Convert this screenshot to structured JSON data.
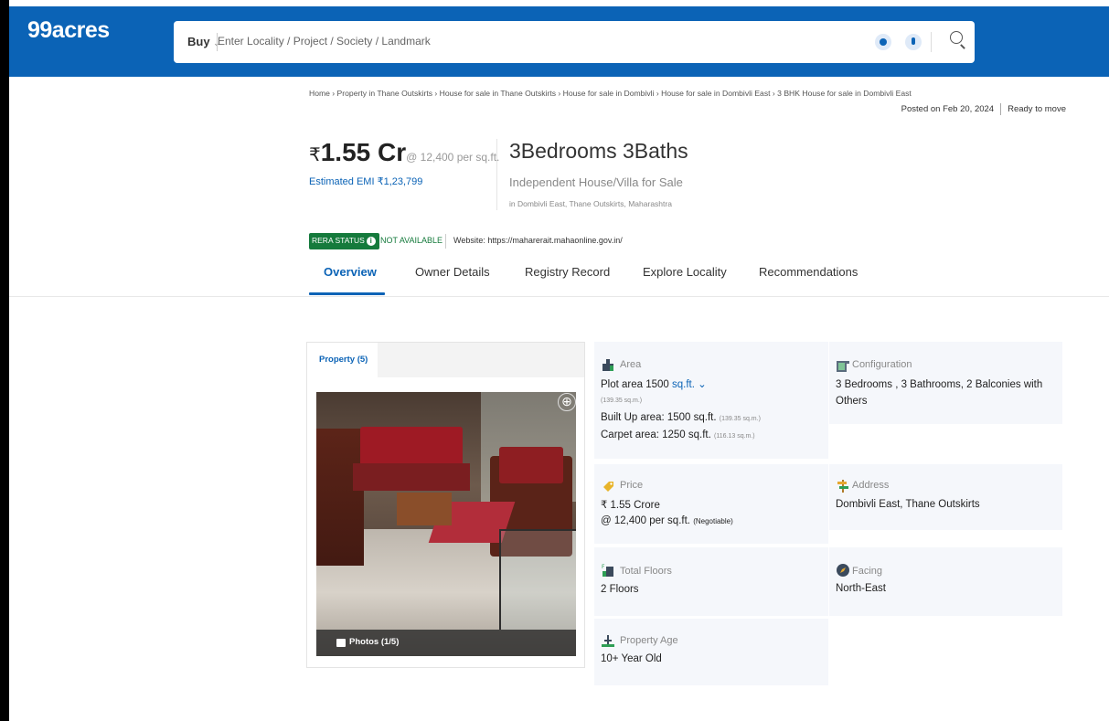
{
  "header": {
    "logo": "99acres",
    "buy_label": "Buy",
    "search_placeholder": "Enter Locality / Project / Society / Landmark"
  },
  "breadcrumb": "Home › Property in Thane Outskirts › House for sale in Thane Outskirts › House for sale in Dombivli › House for sale in Dombivli East › 3 BHK House for sale in Dombivli East",
  "posted": {
    "date": "Posted on Feb 20, 2024",
    "status": "Ready to move"
  },
  "price": {
    "symbol": "₹",
    "main": "1.55 Cr",
    "rate": "@ 12,400 per sq.ft.",
    "emi": "Estimated EMI ₹1,23,799"
  },
  "summary": {
    "bhk": "3Bedrooms 3Baths",
    "type": "Independent House/Villa for Sale",
    "location": "in Dombivli East, Thane Outskirts, Maharashtra"
  },
  "rera": {
    "status_label": "RERA STATUS",
    "status_value": "NOT AVAILABLE",
    "website": "Website: https://maharerait.mahaonline.gov.in/"
  },
  "tabs": [
    {
      "label": "Overview"
    },
    {
      "label": "Owner Details"
    },
    {
      "label": "Registry Record"
    },
    {
      "label": "Explore Locality"
    },
    {
      "label": "Recommendations"
    }
  ],
  "gallery": {
    "tab_label": "Property (5)",
    "photos_label": "Photos (1/5)"
  },
  "details": {
    "area": {
      "title": "Area",
      "plot_prefix": "Plot area 1500",
      "plot_unit": "sq.ft.",
      "plot_sqm": "(139.35 sq.m.)",
      "builtup": "Built Up area: 1500 sq.ft.",
      "builtup_sqm": "(139.35 sq.m.)",
      "carpet": "Carpet area: 1250 sq.ft.",
      "carpet_sqm": "(116.13 sq.m.)"
    },
    "configuration": {
      "title": "Configuration",
      "line1": "3 Bedrooms , 3 Bathrooms, 2 Balconies with",
      "line2": "Others"
    },
    "price": {
      "title": "Price",
      "value": "₹ 1.55 Crore",
      "rate": "@ 12,400 per sq.ft.",
      "negotiable": "(Negotiable)"
    },
    "address": {
      "title": "Address",
      "value": "Dombivli East, Thane Outskirts"
    },
    "floors": {
      "title": "Total Floors",
      "value": "2 Floors"
    },
    "facing": {
      "title": "Facing",
      "value": "North-East"
    },
    "age": {
      "title": "Property Age",
      "value": "10+ Year Old"
    }
  },
  "colors": {
    "brand_blue": "#0b63b6",
    "rera_green": "#157a3c",
    "card_bg": "#f5f7fb"
  }
}
